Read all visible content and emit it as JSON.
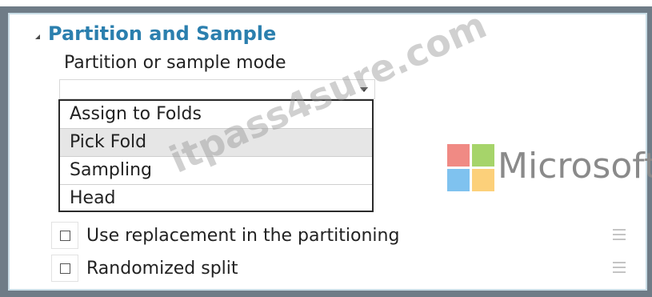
{
  "section": {
    "title": "Partition and Sample"
  },
  "mode_field": {
    "label": "Partition or sample mode",
    "value": "",
    "options": [
      "Assign to Folds",
      "Pick Fold",
      "Sampling",
      "Head"
    ],
    "highlighted": "Pick Fold"
  },
  "checkboxes": [
    {
      "label": "Use replacement in the partitioning",
      "checked": false
    },
    {
      "label": "Randomized split",
      "checked": false
    }
  ],
  "logo": {
    "text": "Microsoft",
    "colors": [
      "#f25022",
      "#7fba00",
      "#00a4ef",
      "#ffb900"
    ]
  },
  "watermark": "itpass4sure.com",
  "colors": {
    "accent": "#2b7fae",
    "frame": "#6f7c87"
  }
}
